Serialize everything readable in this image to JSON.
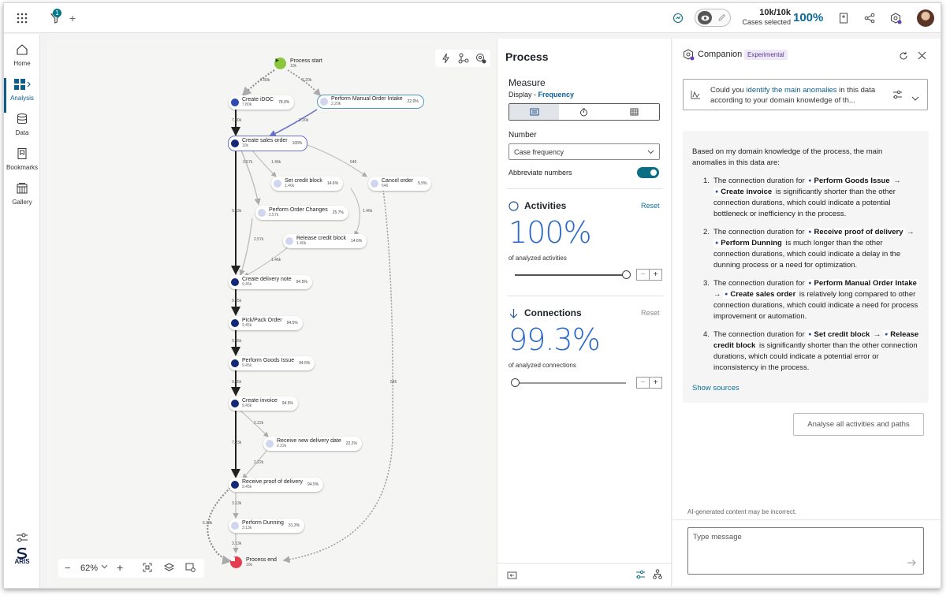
{
  "topbar": {
    "filter_count": "1",
    "cases_value": "10k/10k",
    "cases_label": "Cases selected",
    "cases_percent": "100%"
  },
  "nav": {
    "items": [
      {
        "label": "Home",
        "icon": "home-icon"
      },
      {
        "label": "Analysis",
        "icon": "analysis-grid-icon"
      },
      {
        "label": "Data",
        "icon": "database-icon"
      },
      {
        "label": "Bookmarks",
        "icon": "bookmark-icon"
      },
      {
        "label": "Gallery",
        "icon": "gallery-icon"
      }
    ],
    "logo": "ARIS"
  },
  "canvas": {
    "zoom": "62%",
    "start": {
      "name": "Process start",
      "count": "10k"
    },
    "end": {
      "name": "Process end",
      "count": "10k"
    },
    "nodes": [
      {
        "name": "Create iDOC",
        "count": "7.80k",
        "pct": "78.0%"
      },
      {
        "name": "Perform Manual Order Intake",
        "count": "2.20k",
        "pct": "22.0%"
      },
      {
        "name": "Create sales order",
        "count": "10k",
        "pct": "100%"
      },
      {
        "name": "Set credit block",
        "count": "1.46k",
        "pct": "14.6%"
      },
      {
        "name": "Cancel order",
        "count": "546",
        "pct": "5.5%"
      },
      {
        "name": "Perform Order Changes",
        "count": "2.57k",
        "pct": "25.7%"
      },
      {
        "name": "Release credit block",
        "count": "1.46k",
        "pct": "14.6%"
      },
      {
        "name": "Create delivery note",
        "count": "9.45k",
        "pct": "94.5%"
      },
      {
        "name": "Pick/Pack Order",
        "count": "9.45k",
        "pct": "94.5%"
      },
      {
        "name": "Perform Goods Issue",
        "count": "9.45k",
        "pct": "94.5%"
      },
      {
        "name": "Create invoice",
        "count": "9.45k",
        "pct": "94.5%"
      },
      {
        "name": "Receive new delivery date",
        "count": "2.22k",
        "pct": "22.2%"
      },
      {
        "name": "Receive proof of delivery",
        "count": "9.45k",
        "pct": "94.5%"
      },
      {
        "name": "Perform Dunning",
        "count": "3.13k",
        "pct": "31.3%"
      }
    ],
    "edge_labels": [
      "7.80k",
      "2.20k",
      "7.80k",
      "2.20k",
      "2.57k",
      "1.46k",
      "546",
      "1.46k",
      "9.43k",
      "2.57k",
      "1.46k",
      "9.45k",
      "9.45k",
      "9.45k",
      "2.22k",
      "7.23k",
      "2.22k",
      "546",
      "3.13k",
      "6.33k",
      "3.13k"
    ]
  },
  "process": {
    "title": "Process",
    "measure": "Measure",
    "display_prefix": "Display - ",
    "display_value": "Frequency",
    "number_label": "Number",
    "number_value": "Case frequency",
    "abbreviate_label": "Abbreviate numbers",
    "activities_title": "Activities",
    "activities_reset": "Reset",
    "activities_value": "100%",
    "activities_caption": "of analyzed activities",
    "activities_level": 1.0,
    "connections_title": "Connections",
    "connections_reset": "Reset",
    "connections_value": "99.3%",
    "connections_caption": "of analyzed connections",
    "connections_level": 0.0,
    "stepper_minus": "−",
    "stepper_plus": "+"
  },
  "companion": {
    "title": "Companion",
    "badge": "Experimental",
    "query_pre": "Could you ",
    "query_link": "identify the main anomalies",
    "query_post": " in this data according to your domain knowledge of th...",
    "intro": "Based on my domain knowledge of the process, the main anomalies in this data are:",
    "items": [
      {
        "num": "1.",
        "pre": "The connection duration for ",
        "a": "Perform Goods Issue",
        "b": "Create invoice",
        "post": " is significantly shorter than the other connection durations, which could indicate a potential bottleneck or inefficiency in the process."
      },
      {
        "num": "2.",
        "pre": "The connection duration for ",
        "a": "Receive proof of delivery",
        "b": "Perform Dunning",
        "post": " is much longer than the other connection durations, which could indicate a delay in the dunning process or a need for optimization."
      },
      {
        "num": "3.",
        "pre": "The connection duration for ",
        "a": "Perform Manual Order Intake",
        "b": "Create sales order",
        "post": " is relatively long compared to other connection durations, which could indicate a need for process improvement or automation."
      },
      {
        "num": "4.",
        "pre": "The connection duration for ",
        "a": "Set credit block",
        "b": "Release credit block",
        "post": " is significantly shorter than the other connection durations, which could indicate a potential error or inconsistency in the process."
      }
    ],
    "arrow": "→",
    "show_sources": "Show sources",
    "analyse_button": "Analyse all activities and paths",
    "disclaimer": "AI-generated content may be incorrect.",
    "input_placeholder": "Type message"
  }
}
